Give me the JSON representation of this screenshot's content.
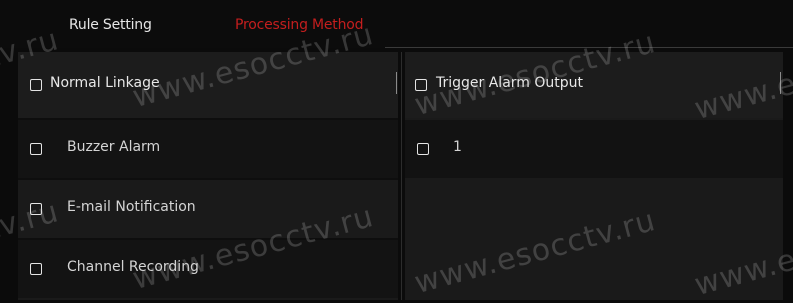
{
  "tabs": [
    {
      "label": "Rule Setting",
      "active": false
    },
    {
      "label": "Processing Method",
      "active": true,
      "color": "#c41e1e"
    }
  ],
  "left_panel": {
    "header": {
      "label": "Normal Linkage",
      "checked": false
    },
    "items": [
      {
        "label": "Buzzer Alarm",
        "checked": false
      },
      {
        "label": "E-mail Notification",
        "checked": false
      },
      {
        "label": "Channel Recording",
        "checked": false
      }
    ]
  },
  "right_panel": {
    "header": {
      "label": "Trigger Alarm Output",
      "checked": false
    },
    "items": [
      {
        "label": "1",
        "checked": false
      }
    ]
  },
  "watermark": {
    "text": "www.esocctv.ru",
    "fragments": [
      "tv.ru",
      "www.e"
    ]
  }
}
